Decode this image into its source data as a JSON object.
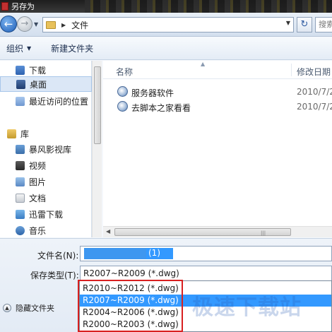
{
  "window": {
    "title": "另存为"
  },
  "address": {
    "current_folder": "文件",
    "search_placeholder": "搜索"
  },
  "toolbar": {
    "organize_label": "组织",
    "new_folder_label": "新建文件夹"
  },
  "sidebar": {
    "items": [
      {
        "label": "下载",
        "icon": "download-folder-icon"
      },
      {
        "label": "桌面",
        "icon": "desktop-icon",
        "selected": true
      },
      {
        "label": "最近访问的位置",
        "icon": "recent-places-icon"
      },
      {
        "label": "库",
        "icon": "library-icon"
      },
      {
        "label": "暴风影视库",
        "icon": "video-library-icon"
      },
      {
        "label": "视频",
        "icon": "video-icon"
      },
      {
        "label": "图片",
        "icon": "pictures-icon"
      },
      {
        "label": "文档",
        "icon": "documents-icon"
      },
      {
        "label": "迅雷下载",
        "icon": "xunlei-download-icon"
      },
      {
        "label": "音乐",
        "icon": "music-icon"
      }
    ]
  },
  "filelist": {
    "columns": {
      "name": "名称",
      "date": "修改日期"
    },
    "files": [
      {
        "name": "服务器软件",
        "date": "2010/7/2",
        "icon": "shortcut-icon"
      },
      {
        "name": "去脚本之家看看",
        "date": "2010/7/2",
        "icon": "shortcut-icon"
      }
    ]
  },
  "form": {
    "filename_label": "文件名(N):",
    "filename_value_suffix": "(1)",
    "savetype_label": "保存类型(T):",
    "savetype_value": "R2007~R2009 (*.dwg)",
    "savetype_options": [
      "R2010~R2012 (*.dwg)",
      "R2007~R2009 (*.dwg)",
      "R2004~R2006 (*.dwg)",
      "R2000~R2003 (*.dwg)"
    ],
    "savetype_selected_index": 1,
    "hide_folders_label": "隐藏文件夹"
  },
  "watermark": {
    "text": "极速下载站"
  },
  "colors": {
    "selection": "#3399ff",
    "highlight_box": "#d82020"
  }
}
